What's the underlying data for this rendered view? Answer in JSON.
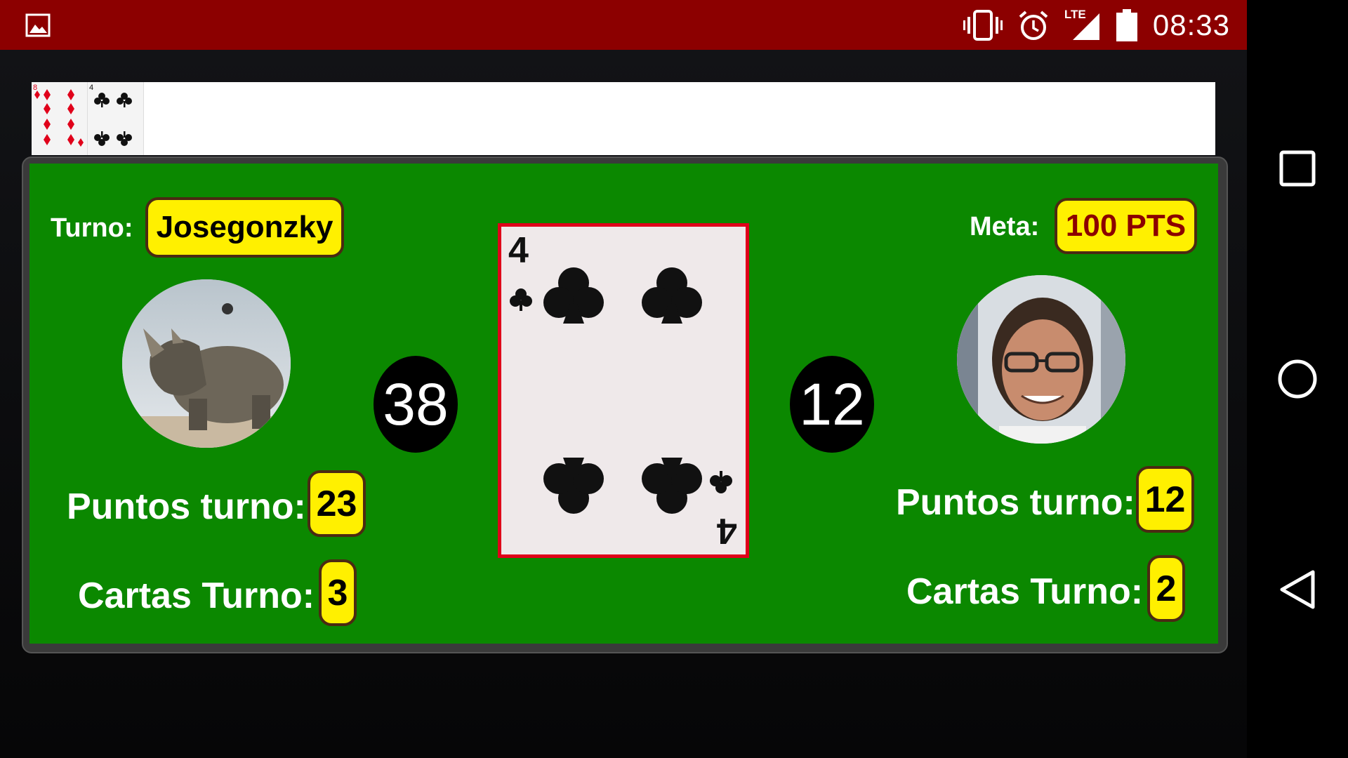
{
  "status_bar": {
    "time": "08:33",
    "network": "LTE"
  },
  "history": {
    "cards": [
      {
        "rank": "8",
        "suit": "diamonds",
        "color": "#e0001a"
      },
      {
        "rank": "4",
        "suit": "clubs",
        "color": "#111111"
      }
    ]
  },
  "game": {
    "turn_label": "Turno:",
    "turn_player": "Josegonzky",
    "goal_label": "Meta:",
    "goal_value": "100 PTS",
    "left_player": {
      "score": "38",
      "turn_points_label": "Puntos turno:",
      "turn_points": "23",
      "turn_cards_label": "Cartas Turno:",
      "turn_cards": "3",
      "avatar": "rhino-avatar"
    },
    "right_player": {
      "score": "12",
      "turn_points_label": "Puntos turno:",
      "turn_points": "12",
      "turn_cards_label": "Cartas Turno:",
      "turn_cards": "2",
      "avatar": "man-avatar"
    },
    "current_card": {
      "rank": "4",
      "suit": "clubs",
      "border_color": "#e0001a"
    }
  },
  "colors": {
    "status_bar": "#8c0000",
    "felt": "#0b8800",
    "pill": "#fff000",
    "goal_text": "#8b0000"
  }
}
